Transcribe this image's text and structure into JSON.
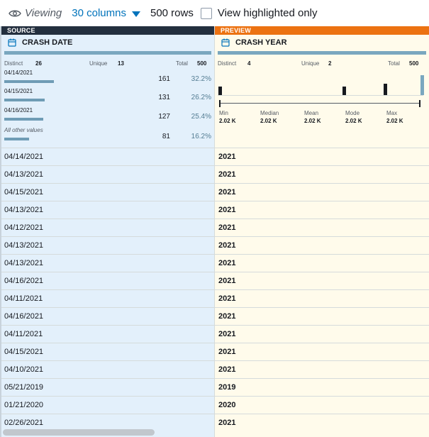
{
  "toolbar": {
    "viewing_label": "Viewing",
    "columns_label": "30 columns",
    "rows_label": "500 rows",
    "highlight_label": "View highlighted only"
  },
  "source": {
    "band": "SOURCE",
    "column_name": "CRASH DATE",
    "stats": {
      "distinct_label": "Distinct",
      "distinct": "26",
      "unique_label": "Unique",
      "unique": "13",
      "total_label": "Total",
      "total": "500"
    },
    "top_values": [
      {
        "label": "04/14/2021",
        "count": "161",
        "pct": "32.2%",
        "fraction": 0.322
      },
      {
        "label": "04/15/2021",
        "count": "131",
        "pct": "26.2%",
        "fraction": 0.262
      },
      {
        "label": "04/16/2021",
        "count": "127",
        "pct": "25.4%",
        "fraction": 0.254
      },
      {
        "label": "All other values",
        "count": "81",
        "pct": "16.2%",
        "fraction": 0.162
      }
    ],
    "cells": [
      "04/14/2021",
      "04/13/2021",
      "04/15/2021",
      "04/13/2021",
      "04/12/2021",
      "04/13/2021",
      "04/13/2021",
      "04/16/2021",
      "04/11/2021",
      "04/16/2021",
      "04/11/2021",
      "04/15/2021",
      "04/10/2021",
      "05/21/2019",
      "01/21/2020",
      "02/26/2021"
    ]
  },
  "preview": {
    "band": "PREVIEW",
    "column_name": "CRASH YEAR",
    "stats": {
      "distinct_label": "Distinct",
      "distinct": "4",
      "unique_label": "Unique",
      "unique": "2",
      "total_label": "Total",
      "total": "500"
    },
    "summary": [
      {
        "label": "Min",
        "value": "2.02 K"
      },
      {
        "label": "Median",
        "value": "2.02 K"
      },
      {
        "label": "Mean",
        "value": "2.02 K"
      },
      {
        "label": "Mode",
        "value": "2.02 K"
      },
      {
        "label": "Max",
        "value": "2.02 K"
      }
    ],
    "cells": [
      "2021",
      "2021",
      "2021",
      "2021",
      "2021",
      "2021",
      "2021",
      "2021",
      "2021",
      "2021",
      "2021",
      "2021",
      "2021",
      "2019",
      "2020",
      "2021"
    ]
  },
  "colors": {
    "accent": "#0073bb",
    "source_band": "#232f3e",
    "preview_band": "#ec7211",
    "source_bg": "#e3f0fb",
    "preview_bg": "#fffbeb"
  }
}
